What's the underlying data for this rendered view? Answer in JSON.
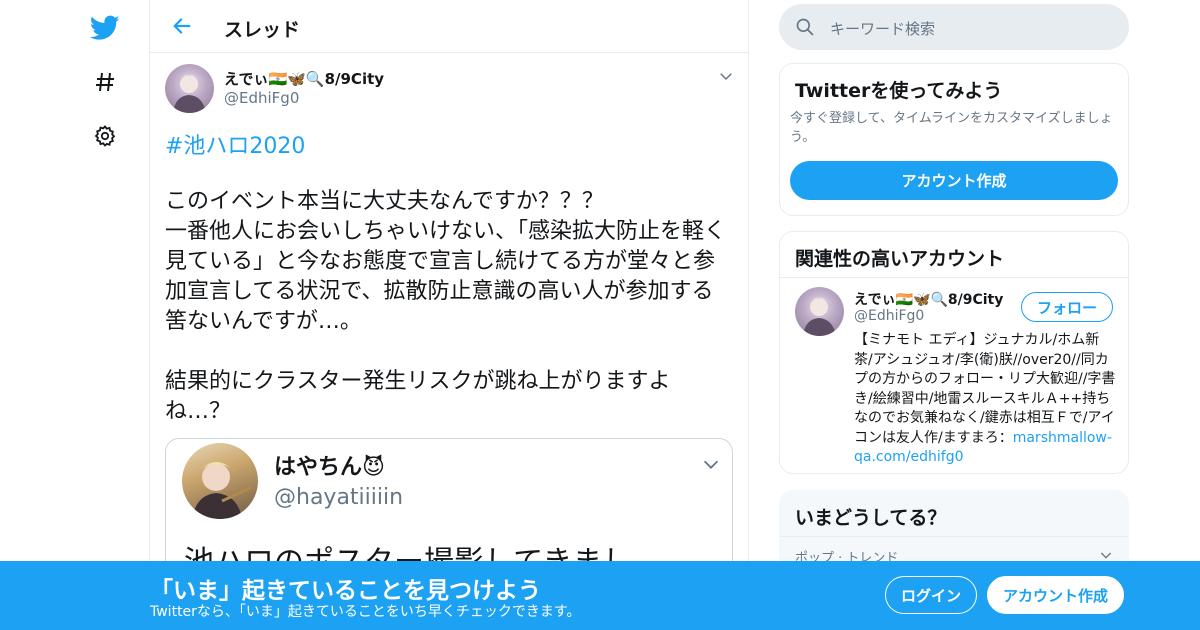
{
  "header": {
    "title": "スレッド"
  },
  "tweet": {
    "author_name": "えでぃ🇮🇳🦋🔍8/9City",
    "author_handle": "@EdhiFg0",
    "hashtag": "#池ハロ2020",
    "text": "このイベント本当に大丈夫なんですか？？？\n一番他人にお会いしちゃいけない、「感染拡大防止を軽く見ている」と今なお態度で宣言し続けてる方が堂々と参加宣言してる状況で、拡散防止意識の高い人が参加する筈ないんですが…。\n\n結果的にクラスター発生リスクが跳ね上がりますよね…？"
  },
  "quote": {
    "name": "はやちん😈",
    "handle": "@hayatiiiiin",
    "text": "池ハロのポスター撮影してきまし"
  },
  "search": {
    "placeholder": "キーワード検索"
  },
  "signup_card": {
    "title": "Twitterを使ってみよう",
    "description": "今すぐ登録して、タイムラインをカスタマイズしましょう。",
    "button": "アカウント作成"
  },
  "related_card": {
    "title": "関連性の高いアカウント",
    "name": "えでぃ🇮🇳🦋🔍8/9City",
    "handle": "@EdhiFg0",
    "follow_button": "フォロー",
    "bio": "【ミナモト エディ】ジュナカル/ホム新茶/アシュジュオ/李(衛)朕//over20//同カプの方からのフォロー・リプ大歓迎//字書き/絵練習中/地雷スルースキルＡ++持ちなのでお気兼ねなく/鍵赤は相互Ｆで/アイコンは友人作/ますまろ：",
    "bio_link": "marshmallow-qa.com/edhifg0"
  },
  "trends_card": {
    "title": "いまどうしてる？",
    "first_item": "ポップ · トレンド"
  },
  "bottom_bar": {
    "headline": "「いま」起きていることを見つけよう",
    "subtext": "Twitterなら、「いま」起きていることをいち早くチェックできます。",
    "login_button": "ログイン",
    "signup_button": "アカウント作成"
  },
  "colors": {
    "accent": "#1da1f2",
    "border": "#e6ecf0",
    "muted": "#657786"
  }
}
